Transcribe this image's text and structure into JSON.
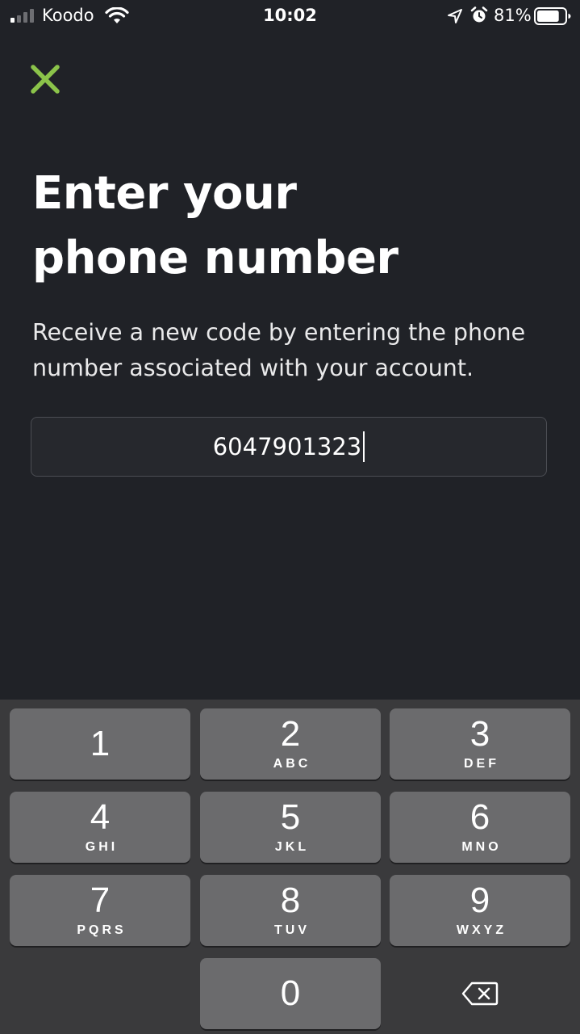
{
  "status_bar": {
    "carrier": "Koodo",
    "time": "10:02",
    "battery_percent": "81%",
    "battery_level": 0.81,
    "signal_bars_active": 1,
    "signal_bars_total": 4,
    "icons": [
      "signal-icon",
      "wifi-icon",
      "location-arrow-icon",
      "alarm-icon",
      "battery-icon"
    ]
  },
  "close_button": {
    "icon": "close-icon",
    "color": "#8bc34a"
  },
  "title": {
    "line1": "Enter your",
    "line2": "phone number"
  },
  "subtitle": "Receive a new code by entering the phone number associated with your account.",
  "phone_input": {
    "value": "6047901323"
  },
  "keypad": {
    "keys": [
      {
        "digit": "1",
        "letters": ""
      },
      {
        "digit": "2",
        "letters": "ABC"
      },
      {
        "digit": "3",
        "letters": "DEF"
      },
      {
        "digit": "4",
        "letters": "GHI"
      },
      {
        "digit": "5",
        "letters": "JKL"
      },
      {
        "digit": "6",
        "letters": "MNO"
      },
      {
        "digit": "7",
        "letters": "PQRS"
      },
      {
        "digit": "8",
        "letters": "TUV"
      },
      {
        "digit": "9",
        "letters": "WXYZ"
      },
      {
        "digit": "0",
        "letters": ""
      }
    ],
    "delete_icon": "backspace-icon"
  },
  "colors": {
    "background": "#202227",
    "accent": "#8bc34a",
    "keypad_background": "#3a3a3c",
    "key": "#6b6b6d"
  }
}
